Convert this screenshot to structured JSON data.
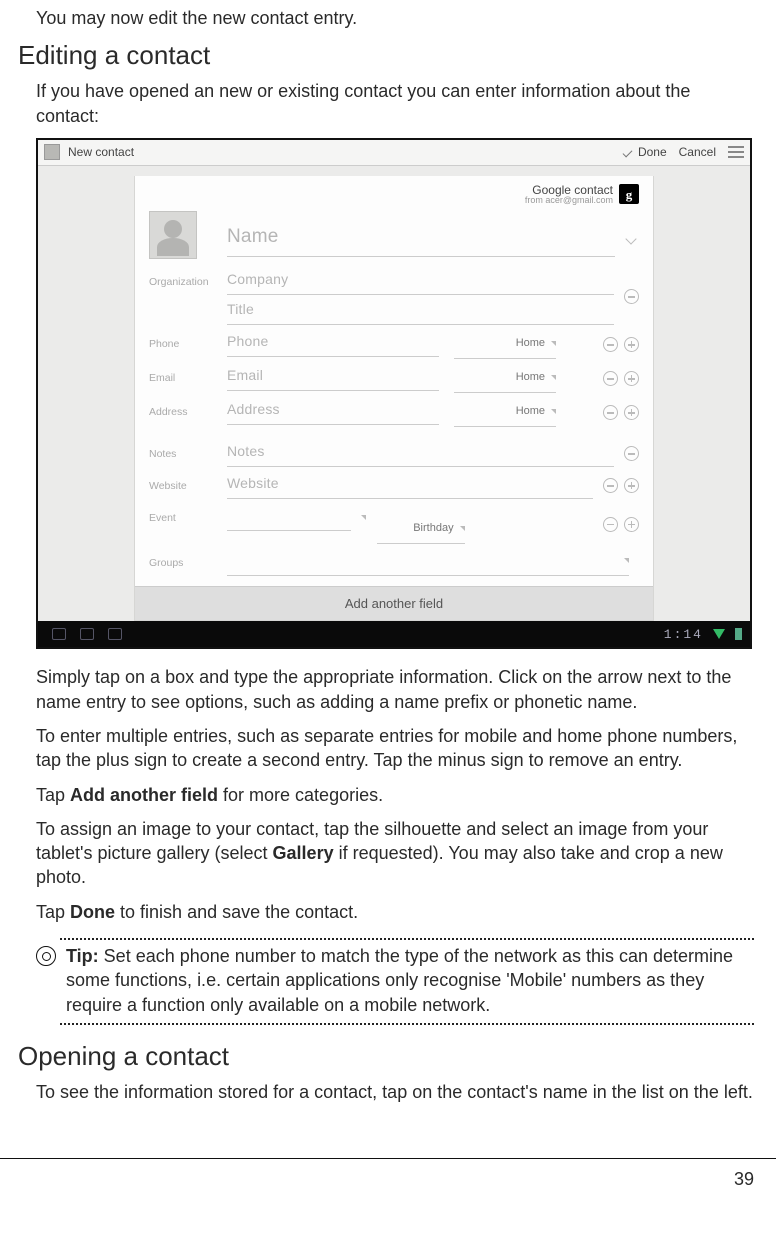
{
  "page_number": "39",
  "intro": "You may now edit the new contact entry.",
  "h_edit": "Editing a contact",
  "p_edit_intro": "If you have opened an new or existing contact you can enter information about the contact:",
  "p_simply": "Simply tap on a box and type the appropriate information. Click on the arrow next to the name entry to see options, such as adding a name prefix or phonetic name.",
  "p_multiple": "To enter multiple entries, such as separate entries for mobile and home phone numbers, tap the plus sign to create a second entry. Tap the minus sign to remove an entry.",
  "p_addfield_pre": "Tap ",
  "p_addfield_bold": "Add another field",
  "p_addfield_post": " for more categories.",
  "p_assign_pre": "To assign an image to your contact, tap the silhouette and select an image from your tablet's picture gallery (select ",
  "p_assign_bold": "Gallery",
  "p_assign_post": " if requested). You may also take and crop a new photo.",
  "p_done_pre": "Tap ",
  "p_done_bold": "Done",
  "p_done_post": " to finish and save the contact.",
  "tip_label": "Tip:",
  "tip_body": " Set each phone number to match the type of the network as this can determine some functions, i.e. certain applications only recognise 'Mobile' numbers as they require a function only available on a mobile network.",
  "h_open": "Opening a contact",
  "p_open": "To see the information stored for a contact, tap on the contact's name in the list on the left.",
  "shot": {
    "topbar": {
      "title": "New contact",
      "done": "Done",
      "cancel": "Cancel"
    },
    "gc_title": "Google contact",
    "gc_sub": "from acer@gmail.com",
    "g_badge": "g",
    "labels": {
      "organization": "Organization",
      "phone": "Phone",
      "email": "Email",
      "address": "Address",
      "notes": "Notes",
      "website": "Website",
      "event": "Event",
      "groups": "Groups"
    },
    "placeholders": {
      "name": "Name",
      "company": "Company",
      "title": "Title",
      "phone": "Phone",
      "email": "Email",
      "address": "Address",
      "notes": "Notes",
      "website": "Website"
    },
    "type_home": "Home",
    "type_birthday": "Birthday",
    "add_another": "Add another field",
    "clock": "1:14"
  }
}
